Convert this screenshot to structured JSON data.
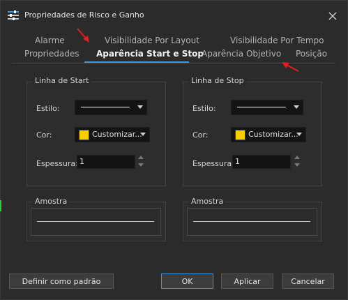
{
  "dialog": {
    "title": "Propriedades de Risco e Ganho"
  },
  "tabs": {
    "row1": [
      "Alarme",
      "Visibilidade Por Layout",
      "Visibilidade Por Tempo"
    ],
    "row2": [
      "Propriedades",
      "Aparência Start e Stop",
      "Aparência Objetivo",
      "Posição"
    ],
    "active": "Aparência Start e Stop"
  },
  "start_group": {
    "title": "Linha de Start",
    "estilo_label": "Estilo:",
    "cor_label": "Cor:",
    "cor_value": "Customizar...",
    "espessura_label": "Espessura:",
    "espessura_value": "1"
  },
  "stop_group": {
    "title": "Linha de Stop",
    "estilo_label": "Estilo:",
    "cor_label": "Cor:",
    "cor_value": "Customizar...",
    "espessura_label": "Espessura:",
    "espessura_value": "1"
  },
  "sample_start": {
    "title": "Amostra"
  },
  "sample_stop": {
    "title": "Amostra"
  },
  "buttons": {
    "default": "Definir como padrão",
    "ok": "OK",
    "apply": "Aplicar",
    "cancel": "Cancelar"
  },
  "colors": {
    "line_color": "#f5d000",
    "accent": "#3b97e6",
    "annotation_arrow": "#e02020"
  }
}
